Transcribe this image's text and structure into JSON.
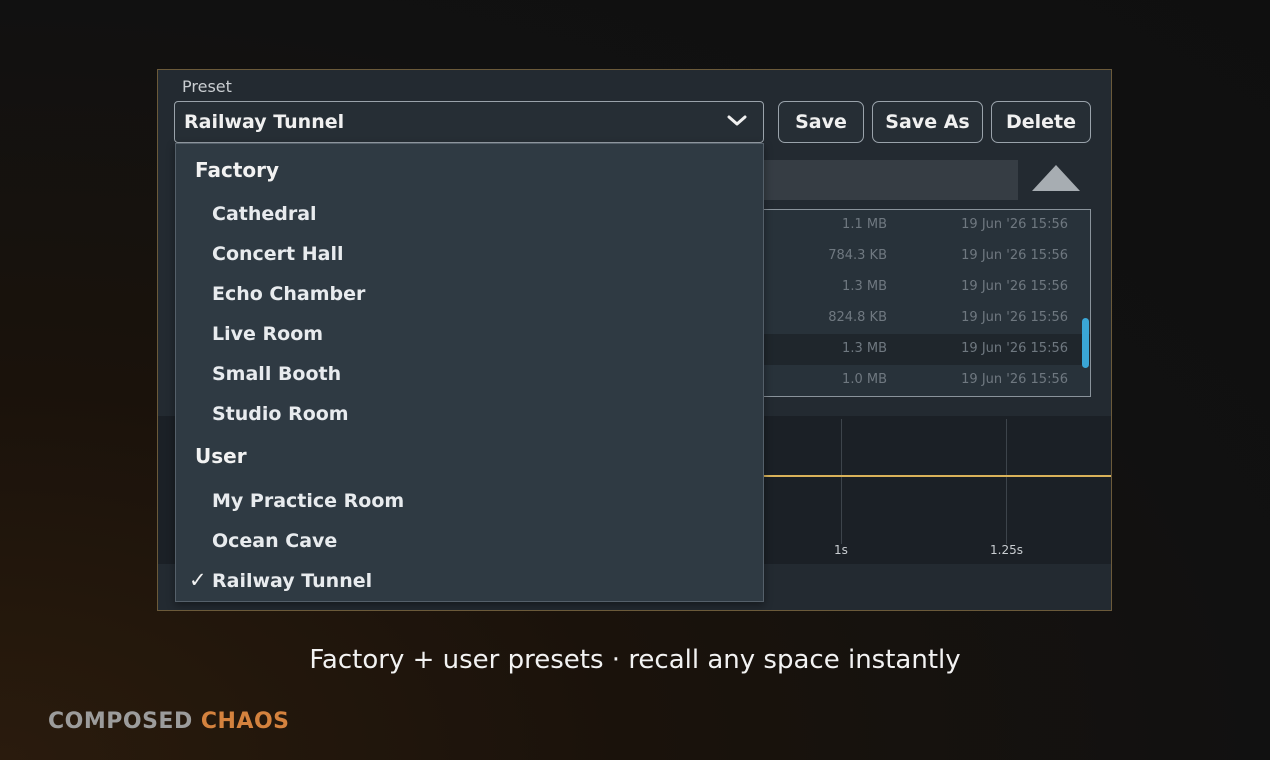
{
  "preset": {
    "label": "Preset",
    "selected": "Railway Tunnel",
    "buttons": {
      "save": "Save",
      "save_as": "Save As",
      "delete": "Delete"
    }
  },
  "dropdown": {
    "groups": [
      {
        "name": "Factory",
        "items": [
          "Cathedral",
          "Concert Hall",
          "Echo Chamber",
          "Live Room",
          "Small Booth",
          "Studio Room"
        ]
      },
      {
        "name": "User",
        "items": [
          "My Practice Room",
          "Ocean Cave",
          "Railway Tunnel"
        ]
      }
    ],
    "checked_item": "Railway Tunnel",
    "check_glyph": "✓"
  },
  "file_list": {
    "rows": [
      {
        "size": "1.1 MB",
        "date": "19 Jun '26 15:56"
      },
      {
        "size": "784.3 KB",
        "date": "19 Jun '26 15:56"
      },
      {
        "size": "1.3 MB",
        "date": "19 Jun '26 15:56"
      },
      {
        "size": "824.8 KB",
        "date": "19 Jun '26 15:56"
      },
      {
        "size": "1.3 MB",
        "date": "19 Jun '26 15:56",
        "selected": true
      },
      {
        "size": "1.0 MB",
        "date": "19 Jun '26 15:56"
      }
    ]
  },
  "timeline": {
    "ticks": [
      "1s",
      "1.25s"
    ],
    "envelope_color": "#d9b25a"
  },
  "caption": "Factory + user presets · recall any space instantly",
  "brand": {
    "part1": "COMPOSED",
    "part2": "CHAOS",
    "accent": "#d4823e"
  }
}
